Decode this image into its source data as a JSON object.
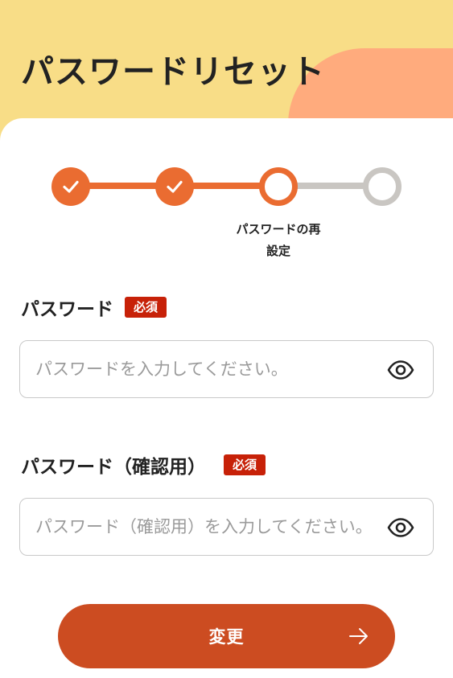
{
  "header": {
    "title": "パスワードリセット"
  },
  "stepper": {
    "steps": [
      {
        "status": "done",
        "icon": "check-icon"
      },
      {
        "status": "done",
        "icon": "check-icon"
      },
      {
        "status": "current",
        "label": "パスワードの再設定"
      },
      {
        "status": "todo"
      }
    ],
    "current_label_line1": "パスワードの再",
    "current_label_line2": "設定"
  },
  "form": {
    "password": {
      "label": "パスワード",
      "required_badge": "必須",
      "placeholder": "パスワードを入力してください。",
      "value": "",
      "toggle_icon": "eye-icon"
    },
    "password_confirm": {
      "label": "パスワード（確認用）",
      "required_badge": "必須",
      "placeholder": "パスワード（確認用）を入力してください。",
      "value": "",
      "toggle_icon": "eye-icon"
    },
    "submit": {
      "label": "変更",
      "icon": "arrow-right-icon"
    }
  },
  "colors": {
    "header_bg": "#f8dd87",
    "accent_blob": "#ffab7d",
    "step_active": "#ea6c31",
    "step_inactive": "#c9c6c2",
    "required_badge": "#c72108",
    "button": "#cc4c21"
  }
}
